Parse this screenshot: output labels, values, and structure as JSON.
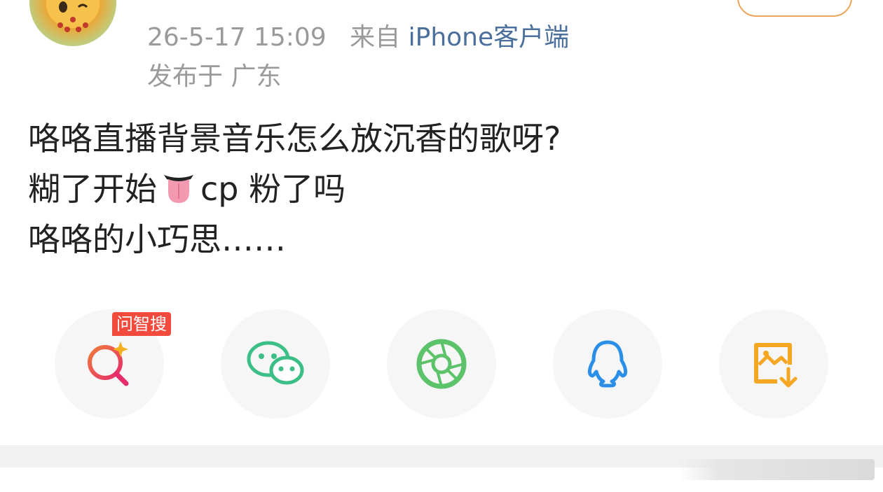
{
  "header": {
    "time": "26-5-17 15:09",
    "from_prefix": "来自",
    "client": "iPhone客户端",
    "location": "发布于 广东"
  },
  "post": {
    "line1": "咯咯直播背景音乐怎么放沉香的歌呀?",
    "line2_before": "糊了开始",
    "line2_emoji": "tongue-emoji",
    "line2_after": "cp 粉了吗",
    "line3": "咯咯的小巧思……"
  },
  "share": {
    "badge": "问智搜",
    "buttons": [
      {
        "icon": "ai-search-icon",
        "color": "#e84a5f"
      },
      {
        "icon": "wechat-icon",
        "color": "#3cbf86"
      },
      {
        "icon": "moments-icon",
        "color": "#5cc36a"
      },
      {
        "icon": "qq-icon",
        "color": "#2b8fe8"
      },
      {
        "icon": "save-image-icon",
        "color": "#f5a623"
      }
    ]
  }
}
